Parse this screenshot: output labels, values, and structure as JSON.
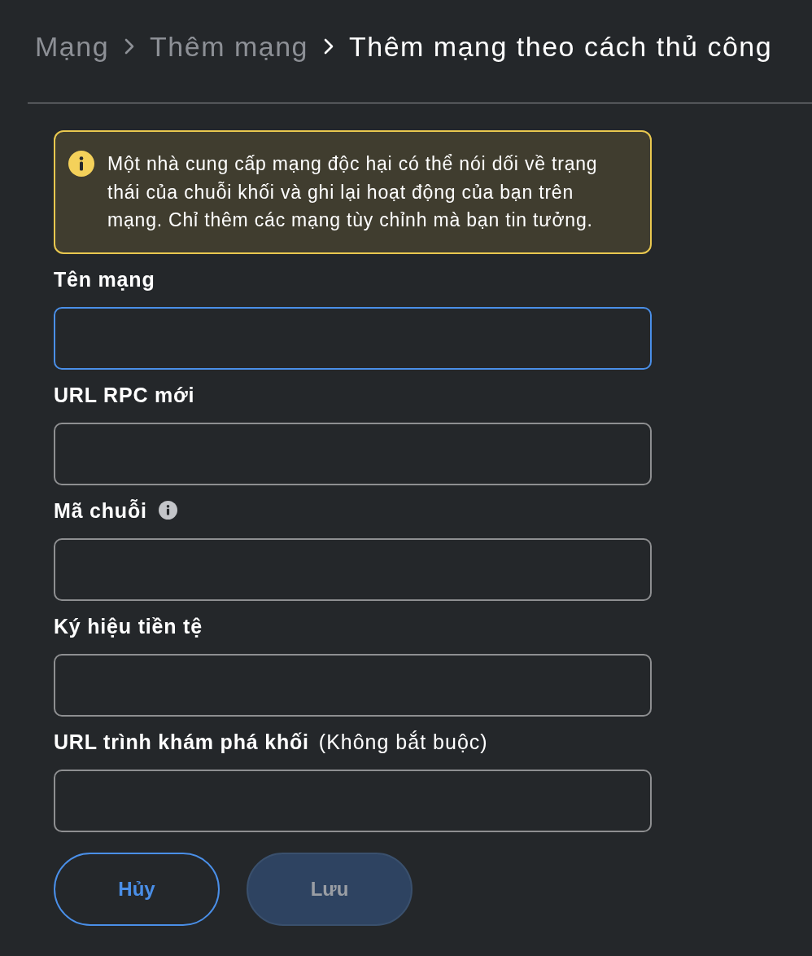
{
  "breadcrumb": [
    {
      "label": "Mạng",
      "current": false
    },
    {
      "label": "Thêm mạng",
      "current": false
    },
    {
      "label": "Thêm mạng theo cách thủ công",
      "current": true
    }
  ],
  "warning": {
    "text": "Một nhà cung cấp mạng độc hại có thể nói dối về trạng thái của chuỗi khối và ghi lại hoạt động của bạn trên mạng. Chỉ thêm các mạng tùy chỉnh mà bạn tin tưởng."
  },
  "fields": [
    {
      "label": "Tên mạng",
      "focused": true,
      "info": false
    },
    {
      "label": "URL RPC mới",
      "focused": false,
      "info": false
    },
    {
      "label": "Mã chuỗi",
      "focused": false,
      "info": true
    },
    {
      "label": "Ký hiệu tiền tệ",
      "focused": false,
      "info": false
    },
    {
      "label": "URL trình khám phá khối",
      "note": "(Không bắt buộc)",
      "focused": false,
      "info": false
    }
  ],
  "buttons": [
    {
      "label": "Hủy",
      "kind": "secondary",
      "disabled": false
    },
    {
      "label": "Lưu",
      "kind": "primary",
      "disabled": true
    }
  ]
}
